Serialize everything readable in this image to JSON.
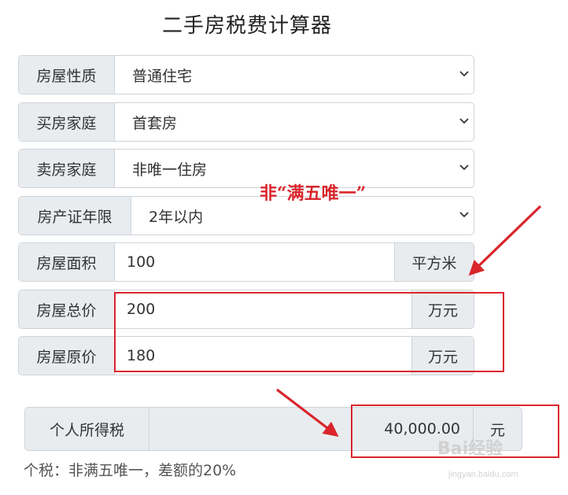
{
  "title": "二手房税费计算器",
  "fields": [
    {
      "label": "房屋性质",
      "value": "普通住宅"
    },
    {
      "label": "买房家庭",
      "value": "首套房"
    },
    {
      "label": "卖房家庭",
      "value": "非唯一住房"
    },
    {
      "label": "房产证年限",
      "value": "2年以内"
    },
    {
      "label": "房屋面积",
      "value": "100",
      "unit": "平方米"
    },
    {
      "label": "房屋总价",
      "value": "200",
      "unit": "万元"
    },
    {
      "label": "房屋原价",
      "value": "180",
      "unit": "万元"
    }
  ],
  "annotation": "非“满五唯一”",
  "result": {
    "label": "个人所得税",
    "value": "40,000.00",
    "unit": "元"
  },
  "note": "个税：非满五唯一，差额的20%",
  "watermark": {
    "main": "Bai经验",
    "sub": "jingyan.baidu.com"
  },
  "colors": {
    "highlight": "#d9262c",
    "addon_bg": "#e9ecef",
    "border": "#ced4da"
  },
  "icons": {
    "select": "chevron-down-icon",
    "arrow": "red-arrow-icon"
  }
}
